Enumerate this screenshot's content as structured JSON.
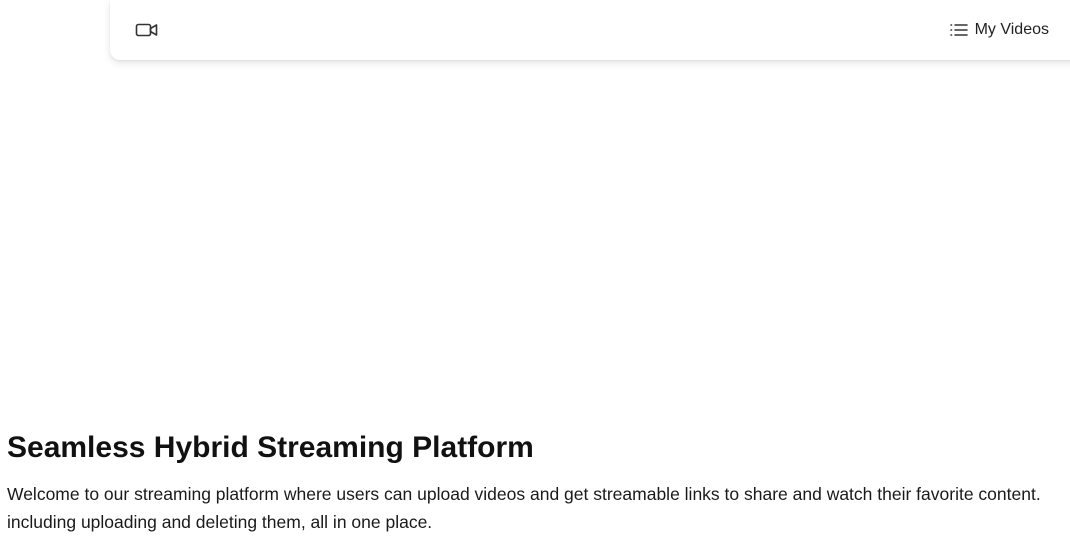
{
  "navbar": {
    "logo_icon": "video-camera-icon",
    "my_videos_icon": "list-icon",
    "my_videos_label": "My Videos"
  },
  "hero": {
    "title": "Seamless Hybrid Streaming Platform",
    "description_line1": "Welcome to our streaming platform where users can upload videos and get streamable links to share and watch their favorite content.",
    "description_line2": "including uploading and deleting them, all in one place."
  },
  "colors": {
    "background": "#ffffff",
    "text": "#111111",
    "icon": "#333333"
  }
}
